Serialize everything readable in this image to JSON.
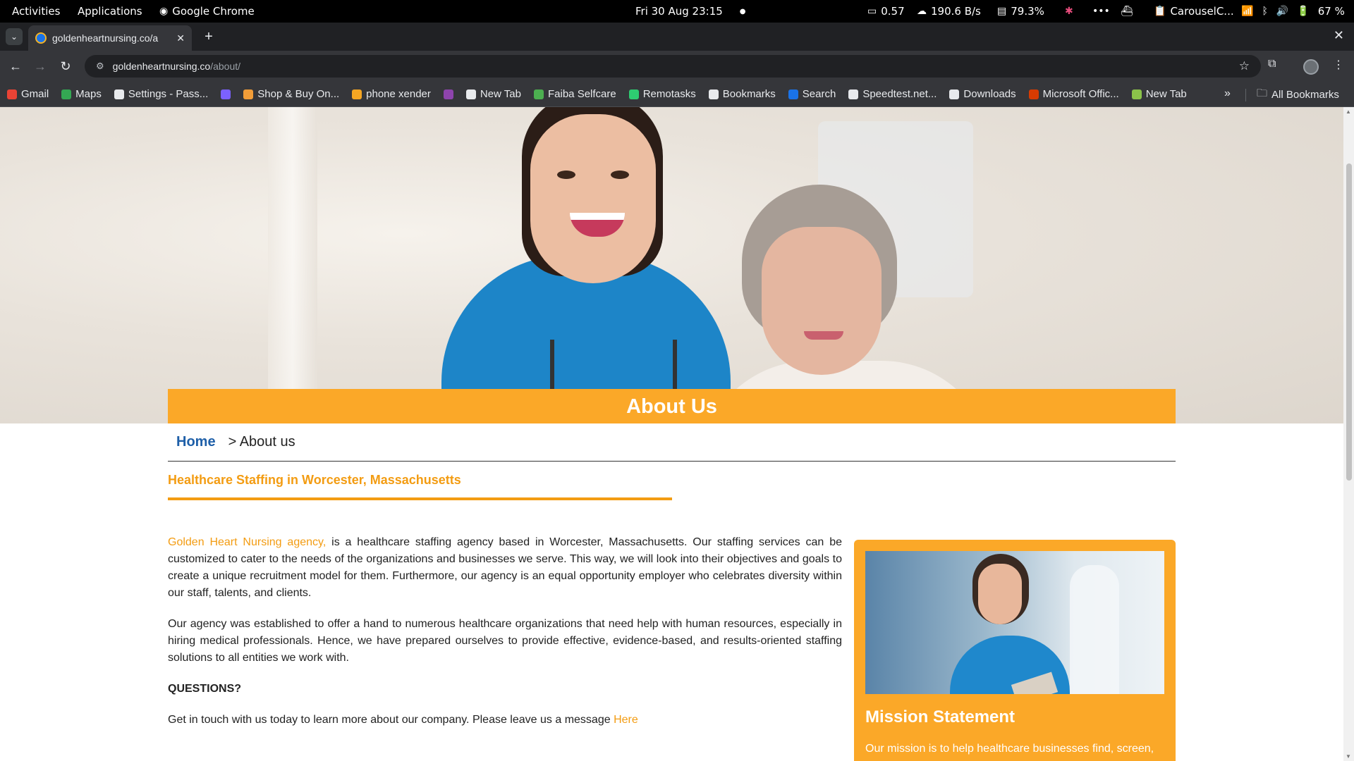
{
  "system_bar": {
    "activities": "Activities",
    "applications": "Applications",
    "app_name": "Google Chrome",
    "datetime": "Fri 30 Aug  23:15",
    "load": "0.57",
    "network": "190.6 B/s",
    "memory": "79.3%",
    "clipboard": "CarouselC...",
    "battery": "67 %"
  },
  "browser": {
    "tab_title": "goldenheartnursing.co/a",
    "url_domain": "goldenheartnursing.co",
    "url_path": "/about/",
    "bookmarks": [
      {
        "label": "Gmail",
        "color": "#ea4335"
      },
      {
        "label": "Maps",
        "color": "#34a853"
      },
      {
        "label": "Settings - Pass...",
        "color": "#e8eaed"
      },
      {
        "label": "",
        "color": "#7b61ff"
      },
      {
        "label": "Shop & Buy On...",
        "color": "#f29d38"
      },
      {
        "label": "phone xender",
        "color": "#f5a623"
      },
      {
        "label": "",
        "color": "#8e44ad"
      },
      {
        "label": "New Tab",
        "color": "#e8eaed"
      },
      {
        "label": "Faiba Selfcare",
        "color": "#4caf50"
      },
      {
        "label": "Remotasks",
        "color": "#2ecc71"
      },
      {
        "label": "Bookmarks",
        "color": "#e8eaed"
      },
      {
        "label": "Search",
        "color": "#1a73e8"
      },
      {
        "label": "Speedtest.net...",
        "color": "#e8eaed"
      },
      {
        "label": "Downloads",
        "color": "#e8eaed"
      },
      {
        "label": "Microsoft Offic...",
        "color": "#d83b01"
      },
      {
        "label": "New Tab",
        "color": "#8bc34a"
      }
    ],
    "all_bookmarks": "All Bookmarks"
  },
  "page": {
    "banner_title": "About Us",
    "breadcrumb_home": "Home",
    "breadcrumb_current": "> About us",
    "section_title": "Healthcare Staffing in Worcester, Massachusetts",
    "p1_link": "Golden Heart Nursing agency,",
    "p1_text": " is a healthcare staffing agency based in Worcester, Massachusetts. Our staffing services can be customized to cater to the needs of the organizations and businesses we serve. This way, we will look into their objectives and goals to create a unique recruitment model for them. Furthermore, our agency is an equal opportunity employer who celebrates diversity within our staff, talents, and clients.",
    "p2_text": "Our agency was established to offer a hand to numerous healthcare organizations that need help with human resources, especially in hiring medical professionals. Hence, we have prepared ourselves to provide effective, evidence-based, and results-oriented staffing solutions to all entities we work with.",
    "questions": "QUESTIONS?",
    "p3_text": "Get in touch with us today to learn more about our company. Please leave us a message ",
    "p3_link": "Here",
    "card_title": "Mission Statement",
    "card_text": "Our mission is to help healthcare businesses find, screen,"
  },
  "colors": {
    "accent": "#fba828",
    "link_orange": "#f39c12",
    "home_blue": "#1e5fa8"
  }
}
